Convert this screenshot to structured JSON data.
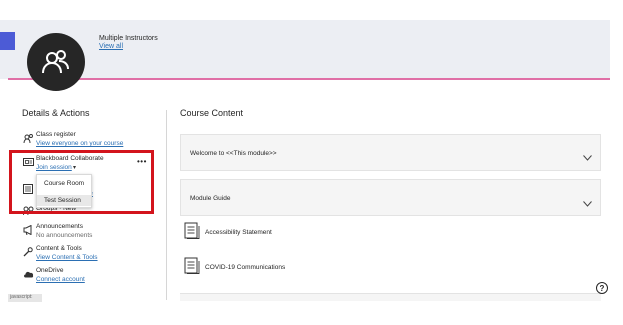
{
  "header": {
    "instructors_label": "Multiple Instructors",
    "view_all_link": "View all",
    "accent_color": "#4c5bd6",
    "underline_color": "#e06fa6"
  },
  "details": {
    "heading": "Details & Actions",
    "items": [
      {
        "title": "Class register",
        "sub": "View everyone on your course",
        "icon": "users-icon"
      },
      {
        "title": "Blackboard Collaborate",
        "sub": "Join session",
        "icon": "video-icon"
      },
      {
        "title": "",
        "sub": "ce",
        "icon": "calendar-icon"
      },
      {
        "title": "Announcements",
        "sub": "No announcements",
        "icon": "megaphone-icon"
      },
      {
        "title": "Content & Tools",
        "sub": "View Content & Tools",
        "icon": "wrench-icon"
      },
      {
        "title": "OneDrive",
        "sub": "Connect account",
        "icon": "cloud-icon"
      }
    ],
    "groups_obscured": "Groups · New",
    "more_label": "•••",
    "dropdown_options": [
      "Course Room",
      "Test Session"
    ],
    "highlight_color": "#d3141c"
  },
  "content": {
    "heading": "Course Content",
    "cards": [
      {
        "title": "Welcome to <<This module>>"
      },
      {
        "title": "Module Guide"
      }
    ],
    "documents": [
      {
        "title": "Accessibility Statement"
      },
      {
        "title": "COVID-19 Communications"
      }
    ]
  },
  "help_label": "?",
  "status_tab_label": "javascript:"
}
